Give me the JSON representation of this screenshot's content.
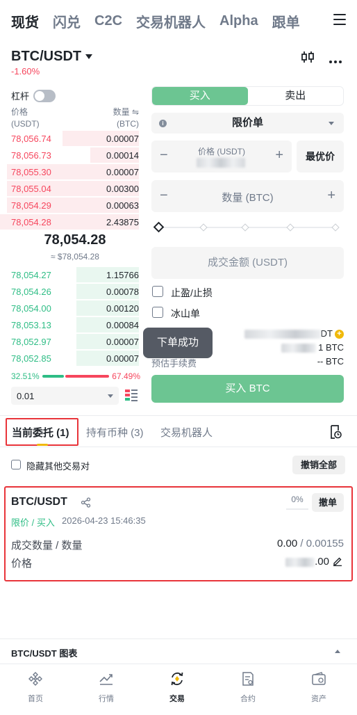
{
  "top_tabs": [
    "现货",
    "闪兑",
    "C2C",
    "交易机器人",
    "Alpha",
    "跟单"
  ],
  "pair": {
    "symbol": "BTC/USDT",
    "change": "-1.60%"
  },
  "orderbook": {
    "leverage_label": "杠杆",
    "price_header": "价格",
    "price_unit": "(USDT)",
    "qty_header": "数量 ⇋",
    "qty_unit": "(BTC)",
    "asks": [
      {
        "price": "78,056.74",
        "qty": "0.00007",
        "depth": 0.55
      },
      {
        "price": "78,056.73",
        "qty": "0.00014",
        "depth": 0.35
      },
      {
        "price": "78,055.30",
        "qty": "0.00007",
        "depth": 0.95
      },
      {
        "price": "78,055.04",
        "qty": "0.00300",
        "depth": 0.95
      },
      {
        "price": "78,054.29",
        "qty": "0.00063",
        "depth": 0.95
      },
      {
        "price": "78,054.28",
        "qty": "2.43875",
        "depth": 1.0
      }
    ],
    "mid_price": "78,054.28",
    "mid_sub": "≈ $78,054.28",
    "bids": [
      {
        "price": "78,054.27",
        "qty": "1.15766",
        "depth": 0.45
      },
      {
        "price": "78,054.26",
        "qty": "0.00078",
        "depth": 0.45
      },
      {
        "price": "78,054.00",
        "qty": "0.00120",
        "depth": 0.45
      },
      {
        "price": "78,053.13",
        "qty": "0.00084",
        "depth": 0.45
      },
      {
        "price": "78,052.97",
        "qty": "0.00007",
        "depth": 0.45
      },
      {
        "price": "78,052.85",
        "qty": "0.00007",
        "depth": 0.45
      }
    ],
    "buy_ratio": "32.51%",
    "sell_ratio": "67.49%",
    "buy_ratio_value": 32.51,
    "depth_precision": "0.01"
  },
  "form": {
    "buy_label": "买入",
    "sell_label": "卖出",
    "order_type": "限价单",
    "price_label": "价格 (USDT)",
    "best_price": "最优价",
    "qty_placeholder": "数量 (BTC)",
    "amount_placeholder": "成交金额 (USDT)",
    "tpsl_label": "止盈/止损",
    "iceberg_label": "冰山单",
    "avail_suffix": "DT",
    "maxbuy_suffix": "1 BTC",
    "fee_label": "预估手续费",
    "fee_value": "-- BTC",
    "toast": "下单成功",
    "submit": "买入 BTC"
  },
  "order_tabs": {
    "open_orders": "当前委托 (1)",
    "holdings": "持有币种 (3)",
    "bots": "交易机器人",
    "hide_other": "隐藏其他交易对",
    "cancel_all": "撤销全部"
  },
  "order": {
    "pair": "BTC/USDT",
    "fill_pct": "0%",
    "cancel": "撤单",
    "type": "限价 / 买入",
    "time": "2026-04-23 15:46:35",
    "filled_label": "成交数量 / 数量",
    "filled": "0.00",
    "sep": " / ",
    "total": "0.00155",
    "price_label": "价格",
    "price_suffix": ".00"
  },
  "chart_bar": {
    "title": "BTC/USDT 图表"
  },
  "nav": [
    {
      "label": "首页",
      "icon": "home-icon"
    },
    {
      "label": "行情",
      "icon": "markets-icon"
    },
    {
      "label": "交易",
      "icon": "trade-icon"
    },
    {
      "label": "合约",
      "icon": "futures-icon"
    },
    {
      "label": "资产",
      "icon": "wallet-icon"
    }
  ],
  "colors": {
    "buy": "#2ebd85",
    "buy_button": "#6cc592",
    "sell": "#f6465d",
    "brand": "#f0b90b",
    "highlight": "#e8343a"
  }
}
